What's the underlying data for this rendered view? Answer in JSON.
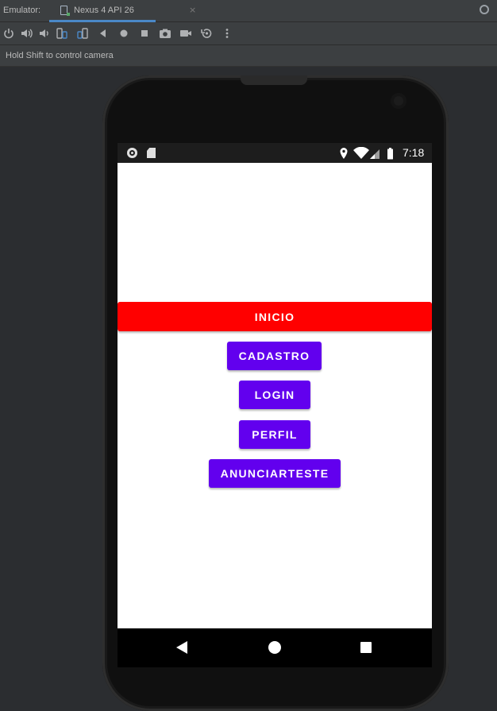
{
  "ide": {
    "emulator_label": "Emulator:",
    "device_tab": "Nexus 4 API 26",
    "tab_close": "×",
    "hint": "Hold Shift to control camera"
  },
  "toolbar": {
    "icons": [
      "power-icon",
      "volume-up-icon",
      "volume-down-icon",
      "rotate-left-icon",
      "rotate-right-icon",
      "back-icon",
      "home-icon",
      "overview-icon",
      "camera-icon",
      "video-icon",
      "snapshot-icon",
      "more-icon"
    ]
  },
  "status_bar": {
    "time": "7:18",
    "icons": [
      "location-icon",
      "wifi-icon",
      "signal-icon",
      "battery-icon"
    ]
  },
  "app": {
    "buttons": {
      "inicio": "INICIO",
      "cadastro": "CADASTRO",
      "login": "LOGIN",
      "perfil": "PERFIL",
      "anunciar": "ANUNCIARTESTE"
    },
    "colors": {
      "inicio_bg": "#ff0000",
      "primary_bg": "#6200ee"
    }
  },
  "nav_bar": {
    "icons": [
      "nav-back-icon",
      "nav-home-icon",
      "nav-recents-icon"
    ]
  }
}
